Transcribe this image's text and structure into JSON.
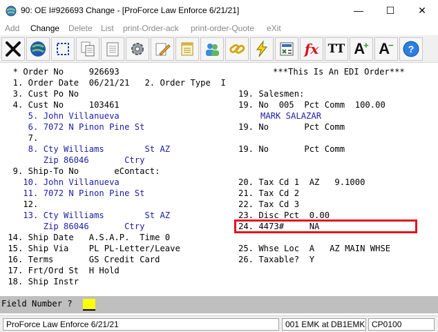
{
  "window": {
    "title": "90: OE I#926693    Change - [ProForce Law Enforce 6/21/21]",
    "minimize": "—",
    "maximize": "☐",
    "close": "✕"
  },
  "menu": [
    {
      "label": "Add",
      "active": false
    },
    {
      "label": "Change",
      "active": true
    },
    {
      "label": "Delete",
      "active": false
    },
    {
      "label": "List",
      "active": false
    },
    {
      "label": "print-Order-ack",
      "active": false
    },
    {
      "label": "print-order-Quote",
      "active": false
    },
    {
      "label": "eXit",
      "active": false
    }
  ],
  "toolbar": {
    "fx_label": "fx",
    "tt_label": "TT",
    "font_up_label": "A",
    "font_down_label": "A",
    "help_label": "?"
  },
  "screen": {
    "l1a": "  * Order No     926693",
    "l1b": "***This Is An EDI Order***",
    "l2a": "  1. Order Date  06/21/21   2. Order Type  I",
    "l3a": "  3. Cust Po No",
    "l3b": "19. Salesmen:",
    "l4a": "  4. Cust No     103461",
    "l4b": "19. No  005  Pct Comm  100.00",
    "l5a": "     5. John Villanueva",
    "l5b": "MARK SALAZAR",
    "l6a": "     6. 7072 N Pinon Pine St",
    "l6b": "19. No       Pct Comm",
    "l7a": "     7.",
    "l8a": "     8. Cty Williams        St AZ",
    "l8b": "19. No       Pct Comm",
    "l9a": "        Zip 86046       Ctry",
    "l10a": "  9. Ship-To No       eContact:",
    "l11a": "    10. John Villanueva",
    "l11b": "20. Tax Cd 1  AZ   9.1000",
    "l12a": "    11. 7072 N Pinon Pine St",
    "l12b": "21. Tax Cd 2",
    "l13a": "    12.",
    "l13b": "22. Tax Cd 3",
    "l14a": "    13. Cty Williams        St AZ",
    "l14b": "23. Disc Pct  0.00",
    "l15a": "        Zip 86046       Ctry",
    "l15b": "24. 4473#     NA",
    "l16a": " 14. Ship Date   A.S.A.P.  Time 0",
    "l17a": " 15. Ship Via    PL PL-Letter/Leave",
    "l17b": "25. Whse Loc  A   AZ MAIN WHSE",
    "l18a": " 16. Terms       GS Credit Card",
    "l18b": "26. Taxable?  Y",
    "l19a": " 17. Frt/Ord St  H Hold",
    "l20a": " 18. Ship Instr"
  },
  "prompt": {
    "label": "Field Number ?"
  },
  "status": {
    "company": "ProForce Law Enforce 6/21/21",
    "user": "001 EMK at DB1EMK",
    "code": "CP0100"
  },
  "colors": {
    "field_value": "#1c1ca4",
    "highlight": "#e0141e",
    "prompt_bg": "#bfbfbf",
    "cursor": "#ffff00"
  }
}
